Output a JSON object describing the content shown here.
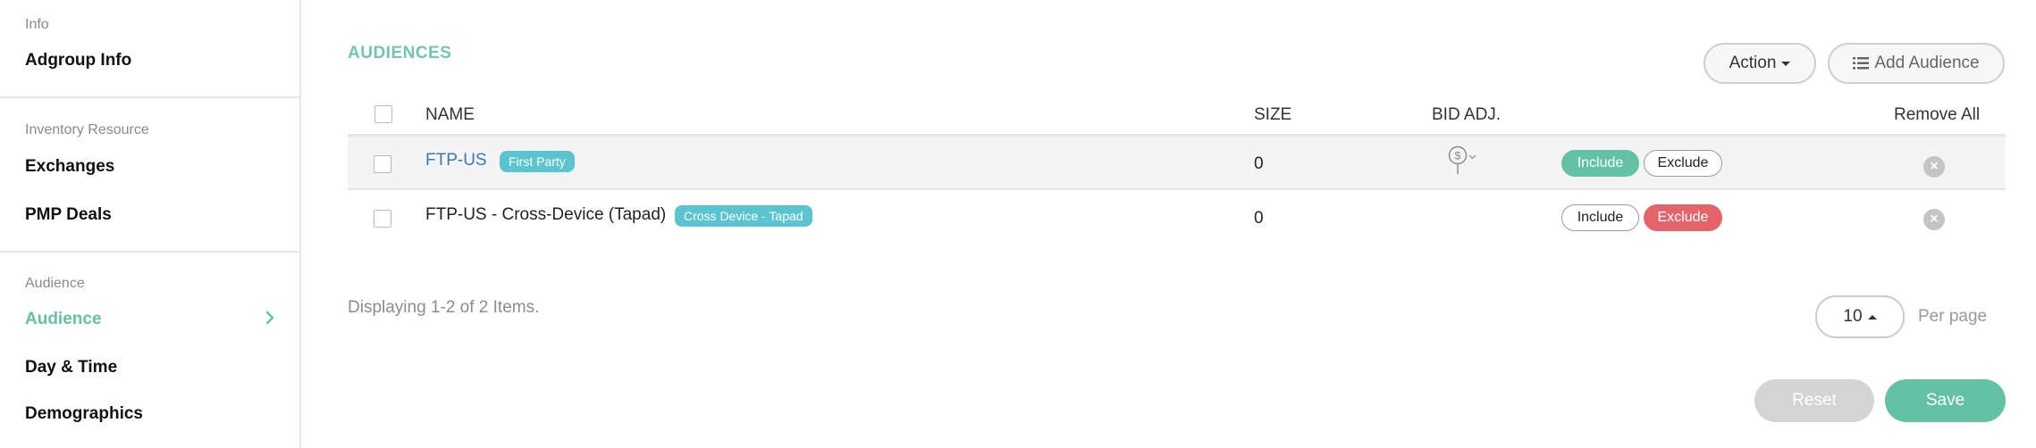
{
  "sidebar": {
    "sections": [
      {
        "label": "Info",
        "items": [
          "Adgroup Info"
        ]
      },
      {
        "label": "Inventory Resource",
        "items": [
          "Exchanges",
          "PMP Deals"
        ]
      },
      {
        "label": "Audience",
        "items": [
          "Audience",
          "Day & Time",
          "Demographics"
        ]
      }
    ],
    "active_item": "Audience"
  },
  "main": {
    "title": "AUDIENCES",
    "action_label": "Action",
    "add_audience_label": "Add Audience",
    "columns": {
      "name": "NAME",
      "size": "SIZE",
      "bid_adj": "BID ADJ.",
      "remove_all": "Remove All"
    },
    "rows": [
      {
        "name": "FTP-US",
        "tag": "First Party",
        "size": "0",
        "include_label": "Include",
        "exclude_label": "Exclude",
        "state": "include",
        "is_link": true,
        "has_bid_icon": true
      },
      {
        "name": "FTP-US - Cross-Device (Tapad)",
        "tag": "Cross Device - Tapad",
        "size": "0",
        "include_label": "Include",
        "exclude_label": "Exclude",
        "state": "exclude",
        "is_link": false,
        "has_bid_icon": false
      }
    ],
    "footer_text": "Displaying 1-2 of 2 Items.",
    "per_page_value": "10",
    "per_page_label": "Per page",
    "reset_label": "Reset",
    "save_label": "Save"
  },
  "colors": {
    "accent": "#63c2a5",
    "exclude": "#e4646a",
    "link": "#3f78ae",
    "tag": "#5bc4d1"
  },
  "icons": [
    "chevron-right-icon",
    "caret-down-icon",
    "list-icon",
    "dollar-pin-icon",
    "chevron-down-icon",
    "remove-icon",
    "caret-up-icon"
  ]
}
